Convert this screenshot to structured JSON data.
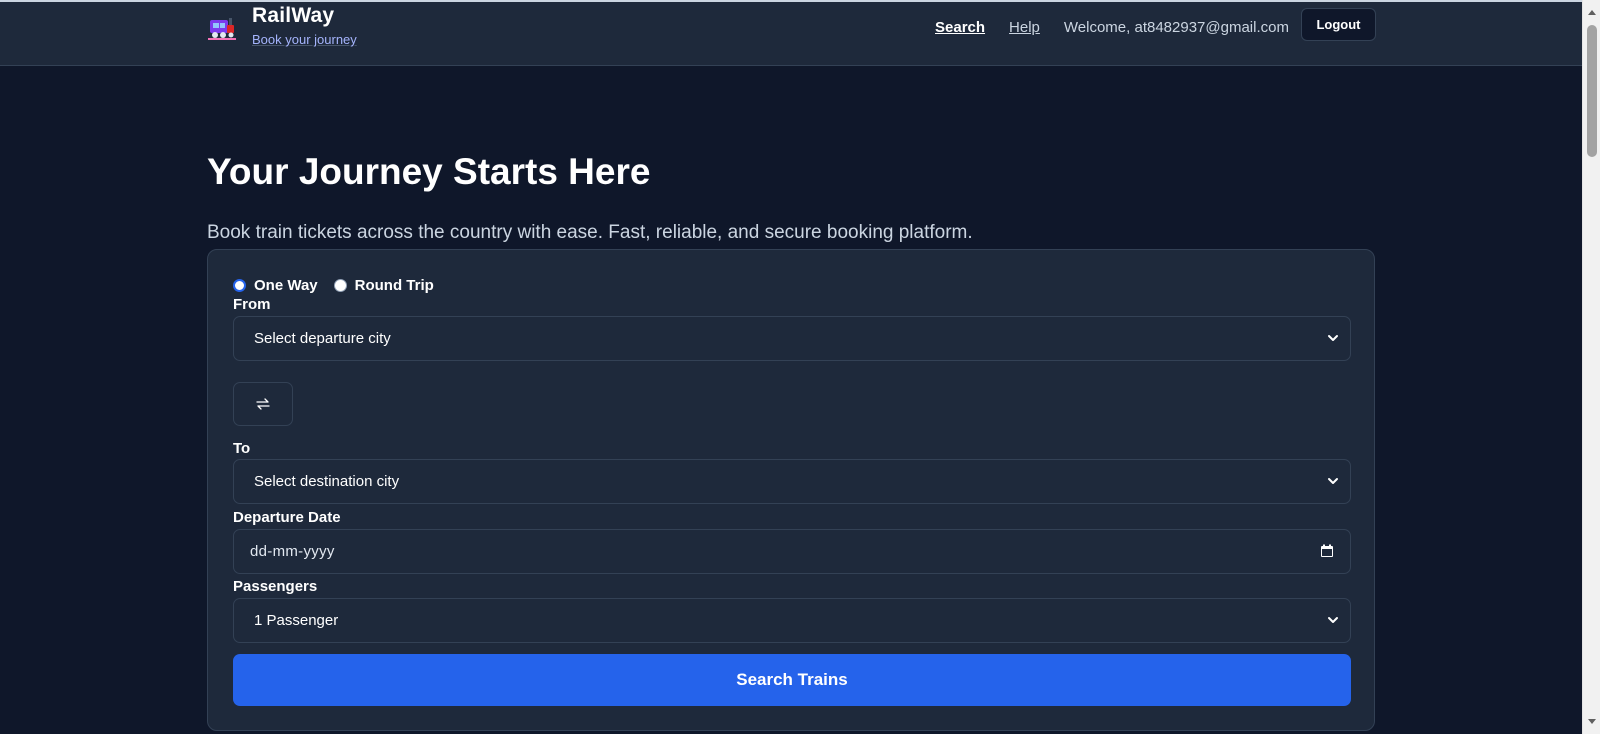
{
  "header": {
    "brand_name": "RailWay",
    "brand_tagline": "Book your journey",
    "nav": [
      {
        "label": "Search",
        "active": true
      },
      {
        "label": "Help",
        "active": false
      }
    ],
    "welcome": "Welcome, at8482937@gmail.com",
    "logout_label": "Logout",
    "logo_icon": "train-icon"
  },
  "hero": {
    "title": "Your Journey Starts Here",
    "subtitle": "Book train tickets across the country with ease. Fast, reliable, and secure booking platform."
  },
  "form": {
    "trip_types": [
      {
        "label": "One Way",
        "selected": true
      },
      {
        "label": "Round Trip",
        "selected": false
      }
    ],
    "from_label": "From",
    "from_value": "Select departure city",
    "swap_icon": "swap-arrows-icon",
    "to_label": "To",
    "to_value": "Select destination city",
    "date_label": "Departure Date",
    "date_value": "dd-mm-yyyy",
    "passengers_label": "Passengers",
    "passengers_value": "1 Passenger",
    "submit_label": "Search Trains"
  },
  "colors": {
    "background": "#0f172a",
    "surface": "#1e293b",
    "border": "#334155",
    "accent": "#2563eb",
    "tagline": "#a5b4fc"
  }
}
